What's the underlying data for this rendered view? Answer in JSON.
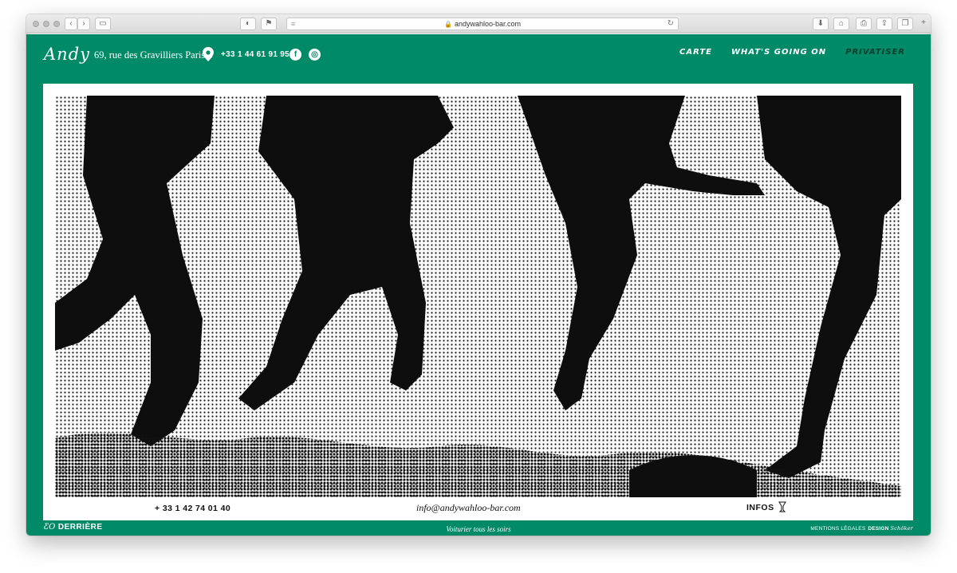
{
  "browser": {
    "url": "andywahloo-bar.com",
    "back_icon": "chevron-left-icon",
    "forward_icon": "chevron-right-icon",
    "sidebar_icon": "sidebar-icon",
    "reload_icon": "reload-icon"
  },
  "header": {
    "logo": "Andy",
    "address": "69, rue des Gravilliers Paris 3",
    "phone": "+33 1 44 61 91 95",
    "social": [
      "facebook-icon",
      "instagram-icon"
    ],
    "nav": [
      {
        "label": "CARTE",
        "active": false
      },
      {
        "label": "WHAT'S GOING ON",
        "active": false
      },
      {
        "label": "PRIVATISER",
        "active": true
      }
    ]
  },
  "contact": {
    "phone": "+ 33 1 42 74 01 40",
    "email": "info@andywahloo-bar.com",
    "infos": "INFOS"
  },
  "footer": {
    "brand_mark": "ƸO",
    "brand_label": "DERRIÈRE",
    "tagline": "Voiturier tous les soirs",
    "legal": "MENTIONS LÉGALES",
    "design_label": "DESIGN",
    "design_credit": "Schöker"
  },
  "colors": {
    "brand_green": "#008a67",
    "nav_active": "#0c3d2e",
    "text_dark": "#111111"
  }
}
